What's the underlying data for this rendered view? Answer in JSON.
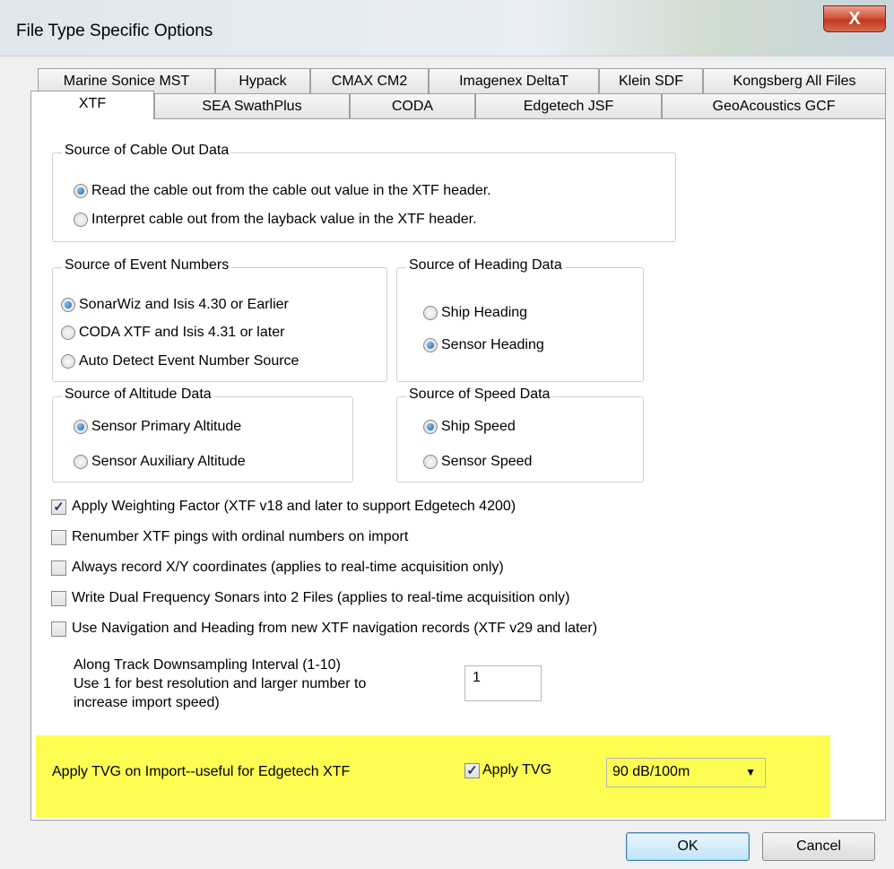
{
  "window": {
    "title": "File Type Specific Options",
    "close_glyph": "X"
  },
  "tabs_row1": [
    "Marine Sonice MST",
    "Hypack",
    "CMAX CM2",
    "Imagenex DeltaT",
    "Klein SDF",
    "Kongsberg All Files"
  ],
  "tabs_row2": [
    "XTF",
    "SEA SwathPlus",
    "CODA",
    "Edgetech JSF",
    "GeoAcoustics GCF"
  ],
  "active_tab": "XTF",
  "cable_out": {
    "legend": "Source of Cable Out Data",
    "options": [
      {
        "label": "Read the cable out from the cable out value in the XTF header.",
        "selected": true
      },
      {
        "label": "Interpret cable out from the layback value in the XTF header.",
        "selected": false
      }
    ]
  },
  "event_numbers": {
    "legend": "Source of Event Numbers",
    "options": [
      {
        "label": "SonarWiz and Isis 4.30 or Earlier",
        "selected": true
      },
      {
        "label": "CODA XTF and Isis 4.31 or later",
        "selected": false
      },
      {
        "label": "Auto Detect Event Number Source",
        "selected": false
      }
    ]
  },
  "heading": {
    "legend": "Source of Heading Data",
    "options": [
      {
        "label": "Ship Heading",
        "selected": false
      },
      {
        "label": "Sensor Heading",
        "selected": true
      }
    ]
  },
  "altitude": {
    "legend": "Source of Altitude Data",
    "options": [
      {
        "label": "Sensor Primary Altitude",
        "selected": true
      },
      {
        "label": "Sensor Auxiliary Altitude",
        "selected": false
      }
    ]
  },
  "speed": {
    "legend": "Source of Speed Data",
    "options": [
      {
        "label": "Ship Speed",
        "selected": true
      },
      {
        "label": "Sensor Speed",
        "selected": false
      }
    ]
  },
  "checkboxes": [
    {
      "label": "Apply Weighting Factor (XTF v18 and later to support Edgetech 4200)",
      "checked": true
    },
    {
      "label": "Renumber XTF pings with ordinal numbers on import",
      "checked": false
    },
    {
      "label": "Always record X/Y coordinates (applies to real-time acquisition only)",
      "checked": false
    },
    {
      "label": "Write Dual Frequency Sonars into 2 Files (applies to real-time acquisition only)",
      "checked": false
    },
    {
      "label": "Use Navigation and Heading from new XTF navigation records (XTF v29 and later)",
      "checked": false
    }
  ],
  "downsampling": {
    "line1": "Along Track Downsampling Interval (1-10)",
    "line2": "Use 1 for best resolution and larger number to",
    "line3": "increase import speed)",
    "value": "1"
  },
  "tvg": {
    "label": "Apply TVG on Import--useful for Edgetech XTF",
    "checkbox_label": "Apply TVG",
    "checked": true,
    "selected_value": "90 dB/100m",
    "highlight_color": "#fdfd52"
  },
  "buttons": {
    "ok": "OK",
    "cancel": "Cancel"
  },
  "check_glyph": "✓",
  "dropdown_glyph": "▼"
}
